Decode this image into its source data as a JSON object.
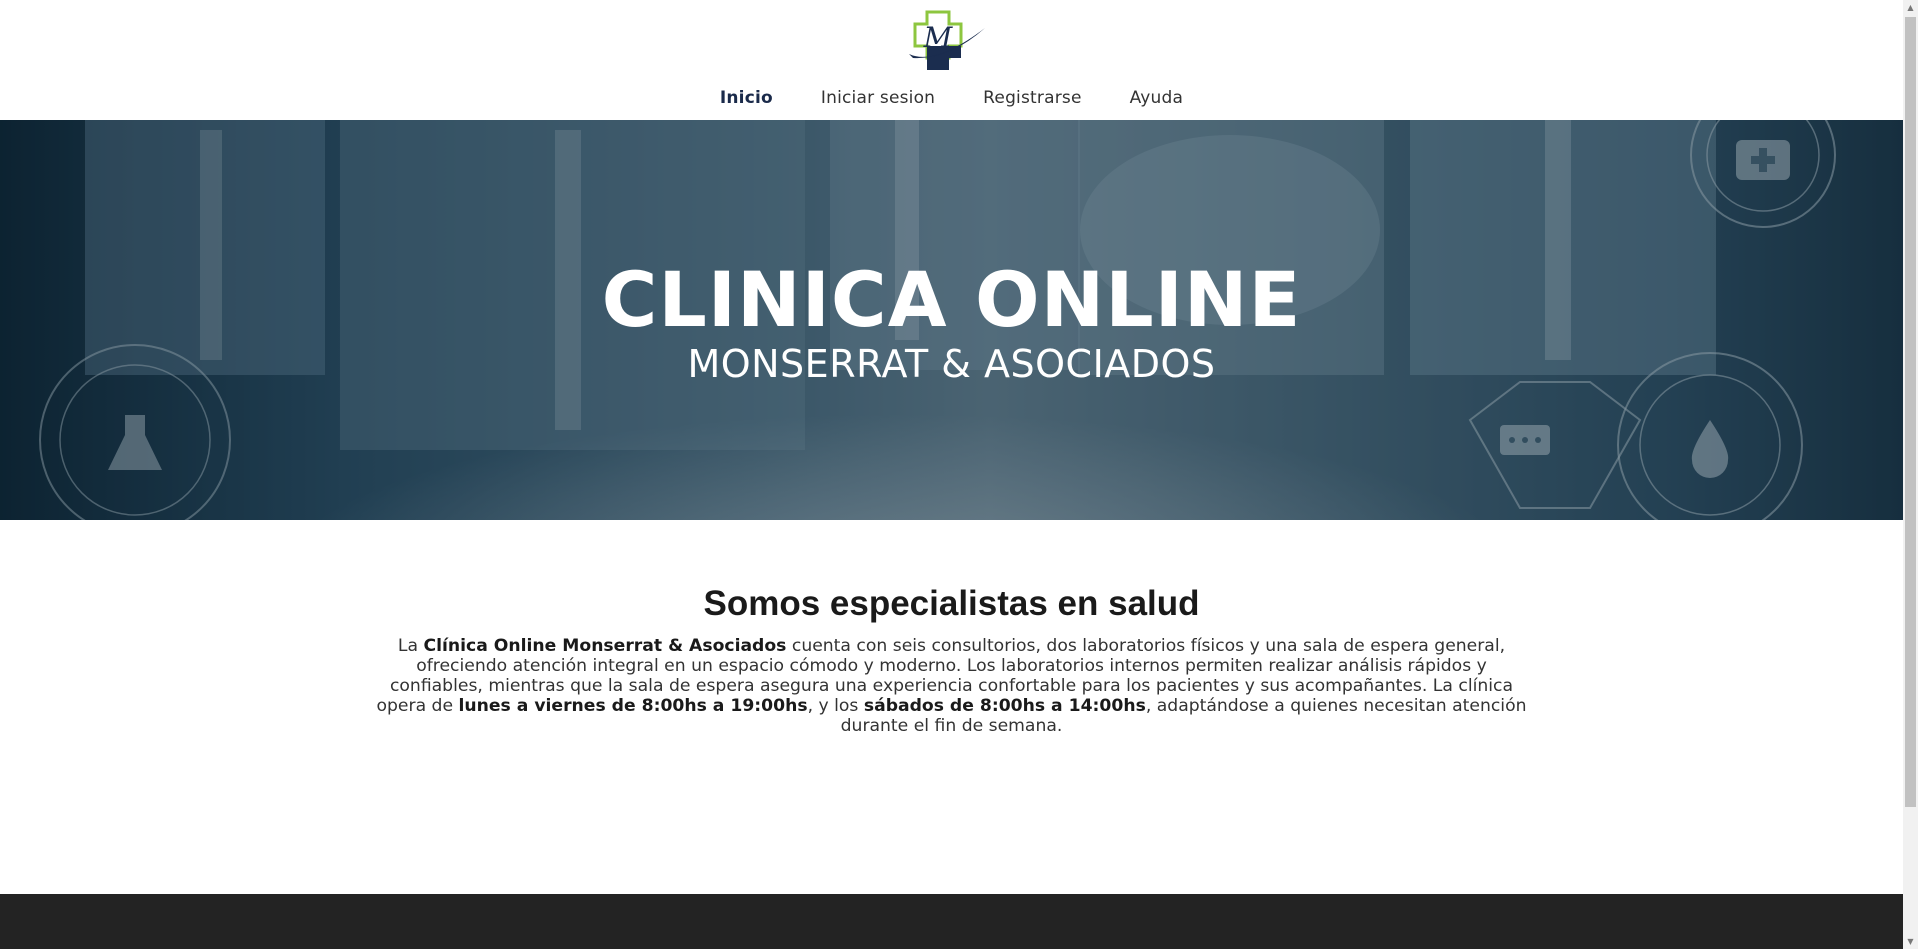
{
  "header": {
    "logo_letter": "M",
    "nav": [
      {
        "label": "Inicio",
        "active": true
      },
      {
        "label": "Iniciar sesion",
        "active": false
      },
      {
        "label": "Registrarse",
        "active": false
      },
      {
        "label": "Ayuda",
        "active": false
      }
    ]
  },
  "hero": {
    "title": "CLINICA ONLINE",
    "subtitle": "MONSERRAT & ASOCIADOS"
  },
  "main": {
    "heading": "Somos especialistas en salud",
    "paragraph": {
      "t1": "La ",
      "b1": "Clínica Online Monserrat & Asociados",
      "t2": " cuenta con seis consultorios, dos laboratorios físicos y una sala de espera general, ofreciendo atención integral en un espacio cómodo y moderno. Los laboratorios internos permiten realizar análisis rápidos y confiables, mientras que la sala de espera asegura una experiencia confortable para los pacientes y sus acompañantes. La clínica opera de ",
      "b2": "lunes a viernes de 8:00hs a 19:00hs",
      "t3": ", y los ",
      "b3": "sábados de 8:00hs a 14:00hs",
      "t4": ", adaptándose a quienes necesitan atención durante el fin de semana."
    }
  },
  "colors": {
    "nav_active": "#1a2a4a",
    "logo_green": "#8dc63f",
    "logo_navy": "#1b2d4f",
    "footer": "#232323"
  },
  "icons": [
    "logo-cross-icon",
    "first-aid-kit-icon",
    "flask-icon",
    "chat-icon",
    "drop-icon"
  ]
}
